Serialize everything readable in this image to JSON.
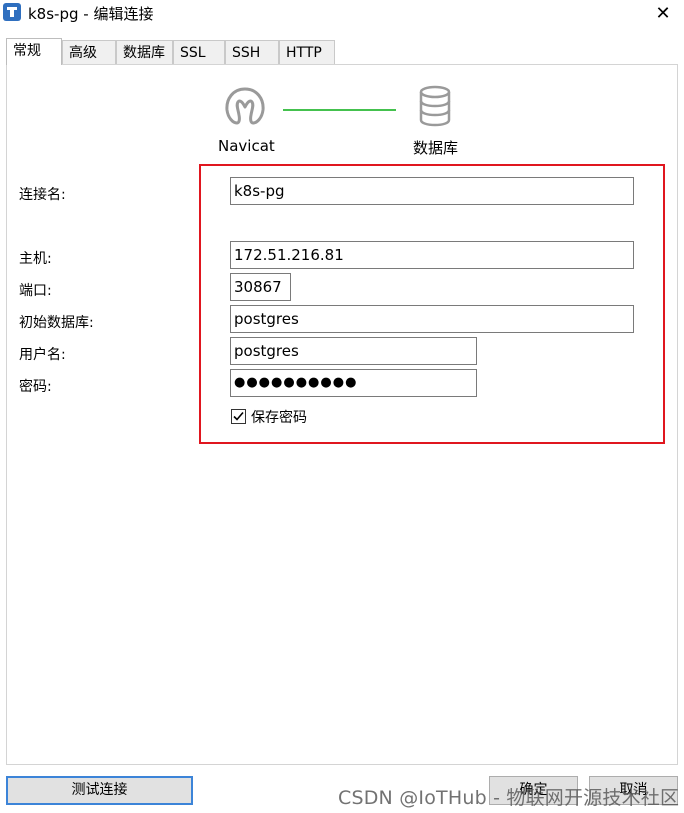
{
  "window": {
    "title": "k8s-pg - 编辑连接",
    "close_glyph": "✕"
  },
  "tabs": [
    {
      "label": "常规",
      "active": true
    },
    {
      "label": "高级"
    },
    {
      "label": "数据库"
    },
    {
      "label": "SSL"
    },
    {
      "label": "SSH"
    },
    {
      "label": "HTTP"
    }
  ],
  "diagram": {
    "left_label": "Navicat",
    "right_label": "数据库",
    "line_color": "#44c14e"
  },
  "form": {
    "connection_name_label": "连接名:",
    "connection_name": "k8s-pg",
    "host_label": "主机:",
    "host": "172.51.216.81",
    "port_label": "端口:",
    "port": "30867",
    "initial_db_label": "初始数据库:",
    "initial_db": "postgres",
    "username_label": "用户名:",
    "username": "postgres",
    "password_label": "密码:",
    "password_mask": "●●●●●●●●●●",
    "save_password_label": "保存密码",
    "save_password_checked": true
  },
  "highlight_color": "#e0161f",
  "buttons": {
    "test": "测试连接",
    "ok": "确定",
    "cancel": "取消"
  },
  "watermark": "CSDN @IoTHub - 物联网开源技术社区"
}
